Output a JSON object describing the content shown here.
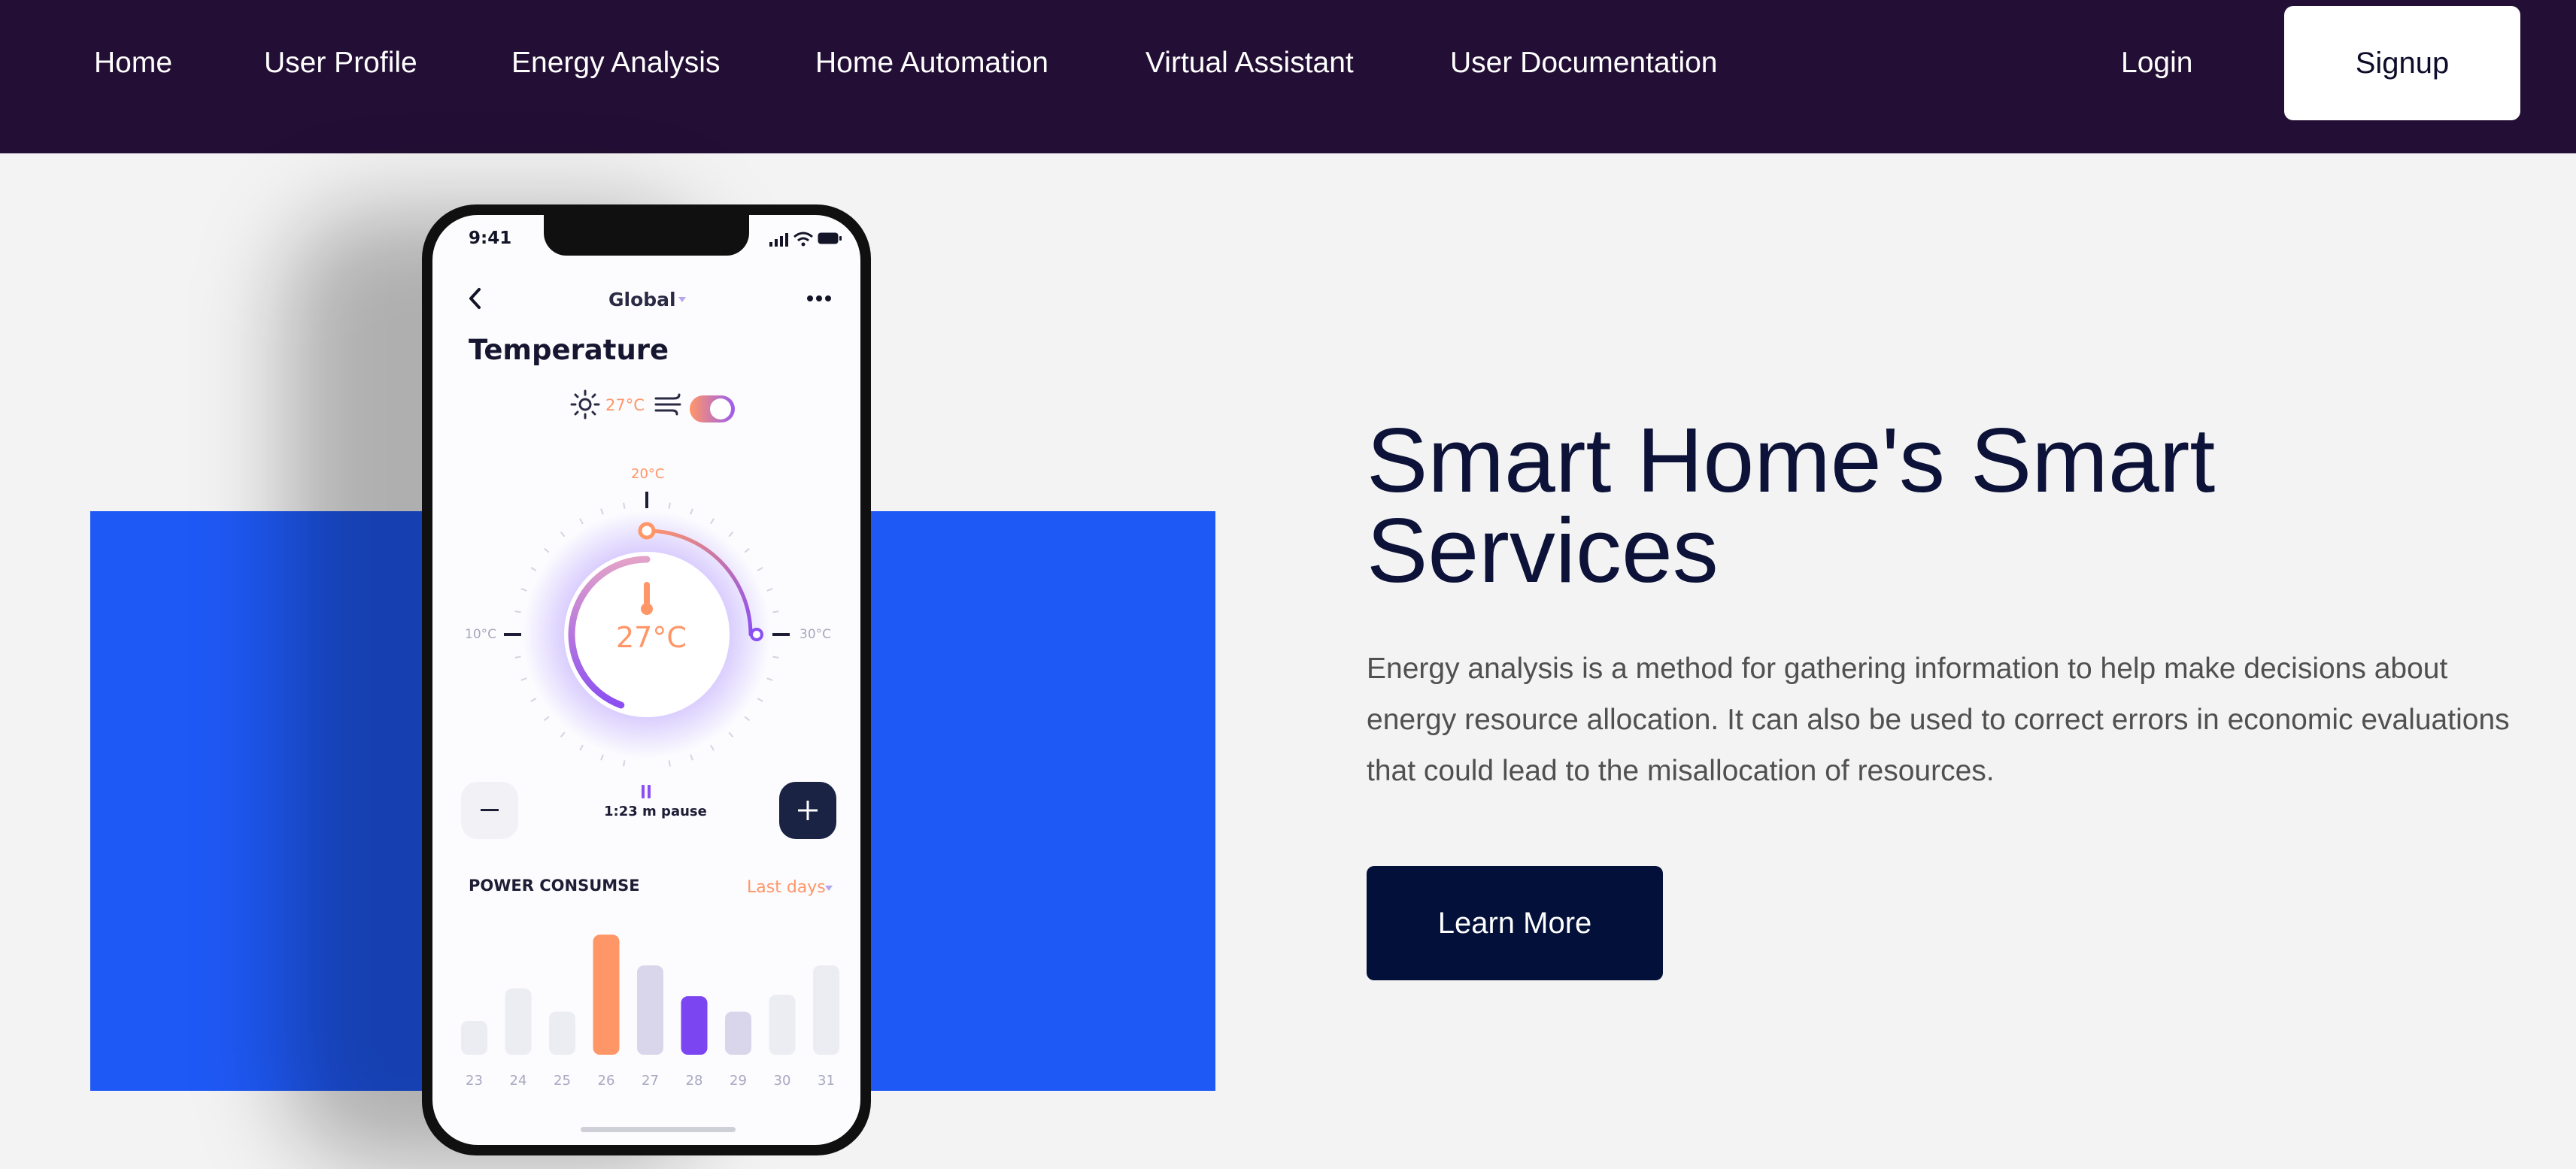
{
  "nav": {
    "links": [
      "Home",
      "User Profile",
      "Energy Analysis",
      "Home Automation",
      "Virtual Assistant",
      "User Documentation"
    ],
    "login": "Login",
    "signup": "Signup"
  },
  "hero": {
    "title_line1": "Smart Home's Smart",
    "title_line2": "Services",
    "description": "Energy analysis is a method for gathering information to help make decisions about energy resource allocation. It can also be used to correct errors in economic evaluations that could lead to the misallocation of resources.",
    "cta": "Learn More"
  },
  "phone": {
    "time": "9:41",
    "header_title": "Global",
    "section_title": "Temperature",
    "outdoor_temp": "27°C",
    "dial": {
      "top_label": "20°C",
      "left_label": "10°C",
      "right_label": "30°C",
      "current": "27°C",
      "min": 10,
      "max": 30,
      "value": 27
    },
    "timer_label": "1:23 m pause",
    "power_title": "POWER CONSUMSE",
    "period": "Last days",
    "chart_days": [
      "23",
      "24",
      "25",
      "26",
      "27",
      "28",
      "29",
      "30",
      "31"
    ],
    "chart_values": [
      22,
      43,
      28,
      78,
      58,
      38,
      28,
      39,
      58
    ],
    "chart_colors": [
      "#ececf3",
      "#ececf3",
      "#ececf3",
      "#ff9668",
      "#d9d5ea",
      "#7b45f2",
      "#d9d5ea",
      "#ececf3",
      "#ececf3"
    ],
    "accent_orange": "#ff9668",
    "accent_purple": "#7b45f2"
  },
  "colors": {
    "nav_bg": "#230f35",
    "blue_panel": "#1f59f5",
    "cta_bg": "#02103a",
    "title": "#0c1238"
  }
}
